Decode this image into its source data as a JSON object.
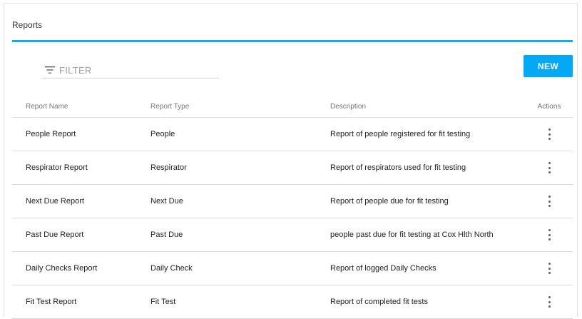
{
  "card": {
    "title": "Reports"
  },
  "filter": {
    "placeholder": "FILTER",
    "value": ""
  },
  "toolbar": {
    "new_label": "NEW"
  },
  "colors": {
    "accent": "#1aa9e8",
    "button": "#03a9f4"
  },
  "table": {
    "headers": {
      "name": "Report Name",
      "type": "Report Type",
      "description": "Description",
      "actions": "Actions"
    },
    "rows": [
      {
        "name": "People Report",
        "type": "People",
        "description": "Report of people registered for fit testing",
        "action_icon": "more-vert-icon"
      },
      {
        "name": "Respirator Report",
        "type": "Respirator",
        "description": "Report of respirators used for fit testing",
        "action_icon": "more-vert-icon"
      },
      {
        "name": "Next Due Report",
        "type": "Next Due",
        "description": "Report of people due for fit testing",
        "action_icon": "more-vert-icon"
      },
      {
        "name": "Past Due Report",
        "type": "Past Due",
        "description": "people past due for fit testing at Cox Hlth North",
        "action_icon": "more-vert-icon"
      },
      {
        "name": "Daily Checks Report",
        "type": "Daily Check",
        "description": "Report of logged Daily Checks",
        "action_icon": "more-vert-icon"
      },
      {
        "name": "Fit Test Report",
        "type": "Fit Test",
        "description": "Report of completed fit tests",
        "action_icon": "more-vert-icon"
      }
    ]
  }
}
